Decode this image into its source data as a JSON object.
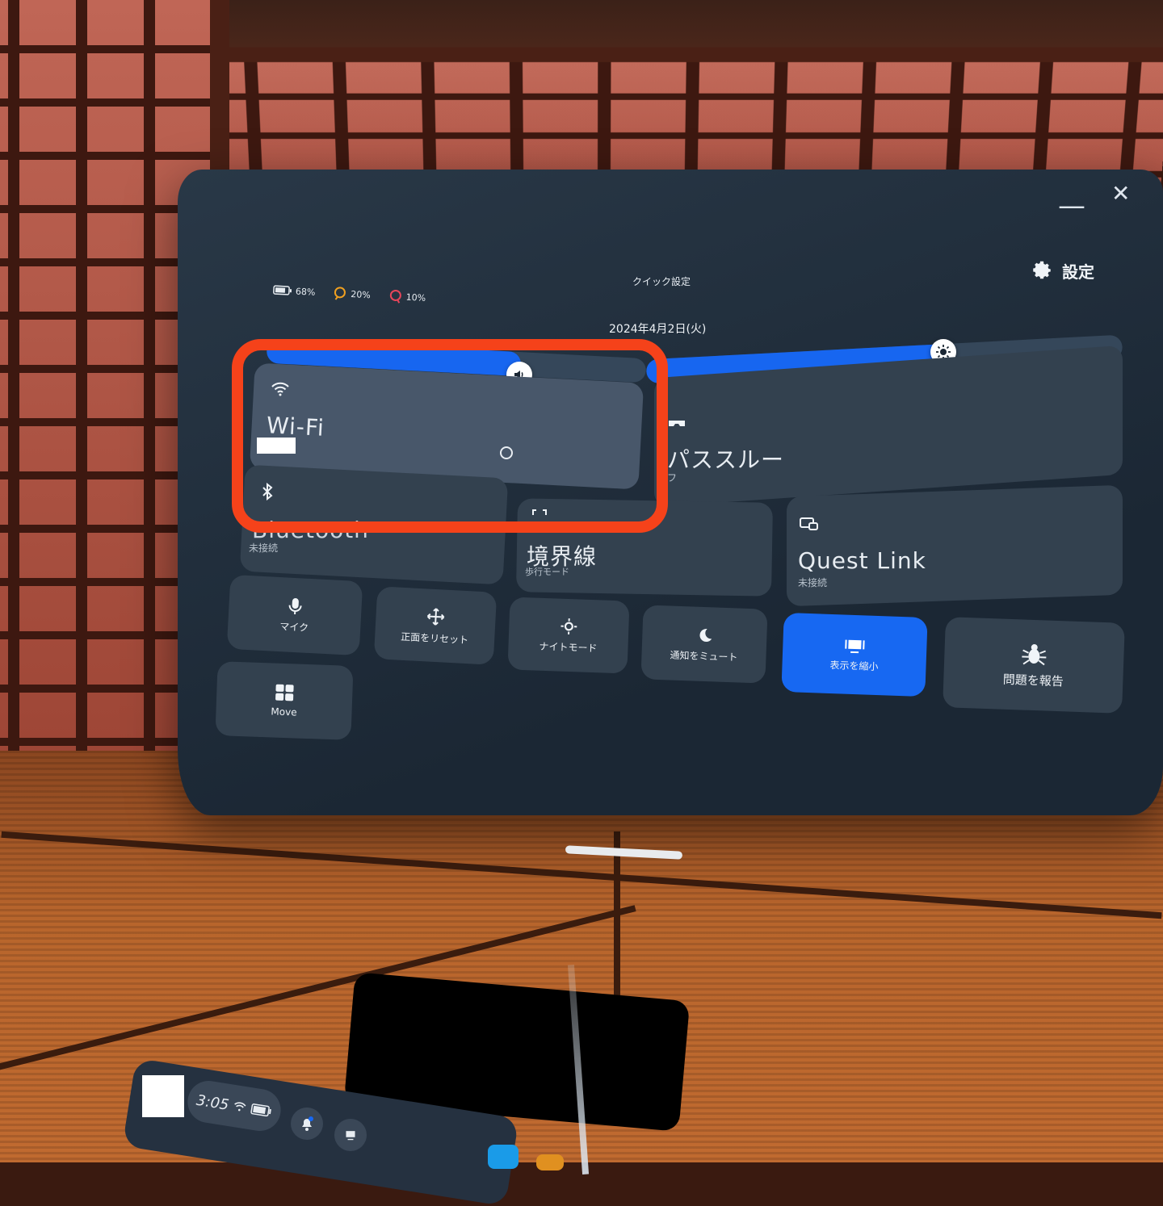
{
  "window": {
    "title": "クイック設定",
    "settings_label": "設定",
    "minimize_glyph": "—",
    "close_glyph": "✕"
  },
  "status": {
    "headset_battery": "68%",
    "left_controller_battery": "20%",
    "right_controller_battery": "10%"
  },
  "date": "2024年4月2日(火)",
  "sliders": {
    "volume": {
      "icon": "speaker-icon",
      "level": 0.44
    },
    "brightness": {
      "icon": "sun-icon",
      "level": 0.8
    }
  },
  "tiles": {
    "wifi": {
      "label": "Wi-Fi",
      "icon": "wifi-icon"
    },
    "passthrough": {
      "label": "パススルー",
      "sub": "フ",
      "icon": "headset-icon"
    },
    "bluetooth": {
      "label": "Bluetooth",
      "sub": "未接続",
      "icon": "bluetooth-icon"
    },
    "boundary": {
      "label": "境界線",
      "sub": "歩行モード",
      "icon": "boundary-icon"
    },
    "quest_link": {
      "label": "Quest Link",
      "sub": "未接続",
      "icon": "link-icon"
    }
  },
  "small_tiles": {
    "mic": "マイク",
    "reset_view": "正面をリセット",
    "night_mode": "ナイトモード",
    "mute_notifications": "通知をミュート",
    "shrink_display": "表示を縮小",
    "report_problem": "問題を報告",
    "move": "Move"
  },
  "taskbar": {
    "time": "3:05"
  },
  "colors": {
    "accent": "#1768f2",
    "highlight": "#f5421a",
    "panel": "#1b2734"
  }
}
